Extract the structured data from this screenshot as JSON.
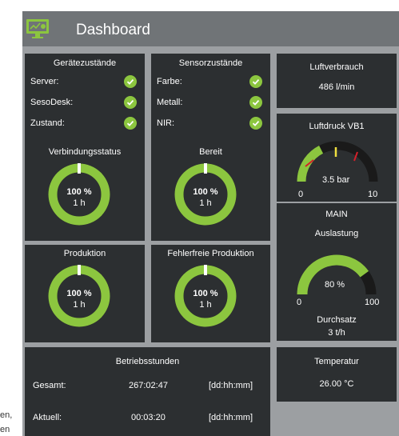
{
  "page": {
    "left_text_1": "en,",
    "left_text_2": "en"
  },
  "header": {
    "title": "Dashboard",
    "logo_icon": "monitor-chart-icon"
  },
  "geraete": {
    "title": "Gerätezustände",
    "items": [
      {
        "label": "Server:"
      },
      {
        "label": "SesoDesk:"
      },
      {
        "label": "Zustand:"
      }
    ]
  },
  "sensor": {
    "title": "Sensorzustände",
    "items": [
      {
        "label": "Farbe:"
      },
      {
        "label": "Metall:"
      },
      {
        "label": "NIR:"
      }
    ]
  },
  "luftverbrauch": {
    "title": "Luftverbrauch",
    "value": "486 l/min"
  },
  "luftdruck": {
    "title": "Luftdruck VB1",
    "value": "3.5 bar",
    "min": "0",
    "max": "10",
    "level": 0.35
  },
  "main": {
    "title": "MAIN",
    "subtitle": "Auslastung",
    "value": "80 %",
    "min": "0",
    "max": "100",
    "level": 0.8,
    "durchsatz_label": "Durchsatz",
    "durchsatz_value": "3 t/h"
  },
  "donuts": [
    {
      "title": "Verbindungsstatus",
      "percent": "100 %",
      "time": "1 h",
      "level": 1.0
    },
    {
      "title": "Bereit",
      "percent": "100 %",
      "time": "1 h",
      "level": 1.0
    },
    {
      "title": "Produktion",
      "percent": "100 %",
      "time": "1 h",
      "level": 1.0
    },
    {
      "title": "Fehlerfreie Produktion",
      "percent": "100 %",
      "time": "1 h",
      "level": 1.0
    }
  ],
  "betrieb": {
    "title": "Betriebsstunden",
    "rows": [
      {
        "label": "Gesamt:",
        "value": "267:02:47",
        "unit": "[dd:hh:mm]"
      },
      {
        "label": "Aktuell:",
        "value": "00:03:20",
        "unit": "[dd:hh:mm]"
      }
    ]
  },
  "temperatur": {
    "title": "Temperatur",
    "value": "26.00 °C"
  },
  "colors": {
    "accent": "#8cc63f",
    "card": "#2c2f31",
    "track": "#1a1a1a"
  }
}
